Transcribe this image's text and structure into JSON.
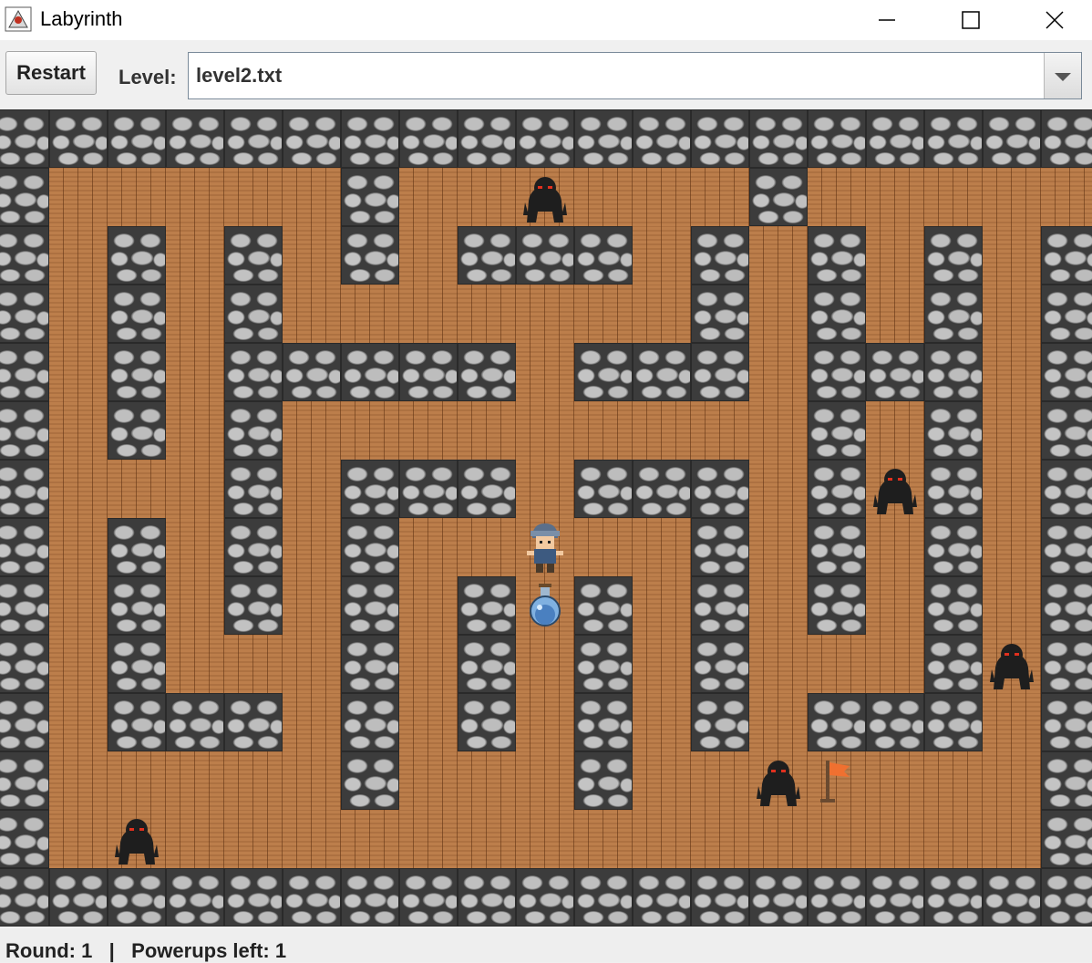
{
  "window": {
    "title": "Labyrinth"
  },
  "toolbar": {
    "restart_label": "Restart",
    "level_label": "Level:",
    "level_value": "level2.txt"
  },
  "status": {
    "round_label": "Round: 1",
    "separator": "|",
    "powerups_label": "Powerups left: 1"
  },
  "colors": {
    "floor": "#b87845",
    "wall": "#8a8a8a",
    "enemy": "#1e1e1e",
    "enemy_eyes": "#e0301e",
    "flag": "#f07030"
  },
  "board": {
    "grid": [
      "###################",
      "#.....#......#.....#",
      "#.#.#.#.###.#.#.#.#",
      "#.#.#.......#.#.#.#",
      "#.#.#####.###.###.#",
      "#.#.#.........#.#.#",
      "#...#.###.###.#.#.#",
      "#.#.#.#.....#.#.#.#",
      "#.#.#.#.#.#.#.#.#.#",
      "#.#...#.#.#.#...#.#",
      "#.###.#.#.#.#.###.#",
      "#.....#...#.......#",
      "#.................#",
      "###################"
    ],
    "entities": [
      {
        "type": "enemy",
        "row": 1,
        "col": 9
      },
      {
        "type": "enemy",
        "row": 6,
        "col": 15
      },
      {
        "type": "enemy",
        "row": 9,
        "col": 17
      },
      {
        "type": "enemy",
        "row": 11,
        "col": 13
      },
      {
        "type": "enemy",
        "row": 12,
        "col": 2
      },
      {
        "type": "player",
        "row": 7,
        "col": 9
      },
      {
        "type": "potion",
        "row": 8,
        "col": 9
      },
      {
        "type": "flag",
        "row": 11,
        "col": 14
      }
    ]
  }
}
